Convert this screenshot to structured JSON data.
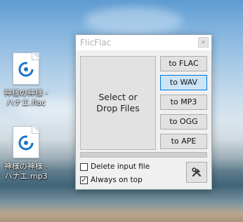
{
  "desktop": {
    "icons": [
      {
        "label_line1": "神様の神様 -",
        "label_line2": "ハナエ.flac",
        "icon": "audio-file-icon"
      },
      {
        "label_line1": "神様の神様 -",
        "label_line2": "ハナエ.mp3",
        "icon": "audio-file-icon"
      }
    ]
  },
  "window": {
    "title": "FlicFlac",
    "close_glyph": "✕",
    "drop_zone": {
      "line1": "Select or",
      "line2": "Drop Files"
    },
    "format_buttons": [
      {
        "label": "to FLAC",
        "highlighted": false
      },
      {
        "label": "to WAV",
        "highlighted": true
      },
      {
        "label": "to MP3",
        "highlighted": false
      },
      {
        "label": "to OGG",
        "highlighted": false
      },
      {
        "label": "to APE",
        "highlighted": false
      }
    ],
    "progress": 0,
    "options": [
      {
        "label": "Delete input file",
        "checked": false
      },
      {
        "label": "Always on top",
        "checked": true
      }
    ],
    "settings_icon": "tools-icon"
  },
  "colors": {
    "accent": "#0078d7",
    "button_hover": "#cce4f7"
  }
}
